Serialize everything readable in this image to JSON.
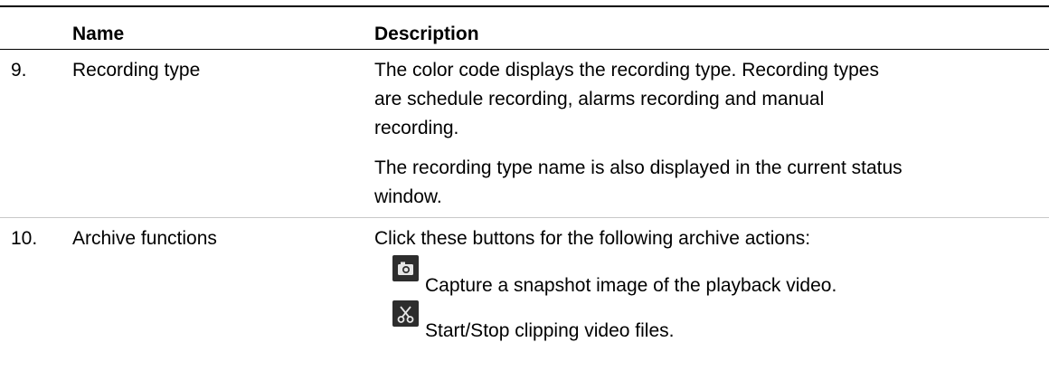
{
  "table": {
    "headers": {
      "name": "Name",
      "description": "Description"
    },
    "rows": [
      {
        "number": "9.",
        "name": "Recording type",
        "description_lines": [
          "The color code displays the recording type. Recording types",
          "are schedule recording, alarms recording and manual",
          "recording."
        ],
        "note_lines": [
          "The recording type name is also displayed in the current status",
          "window."
        ]
      },
      {
        "number": "10.",
        "name": "Archive functions",
        "intro": "Click these buttons for the following archive actions:",
        "actions": [
          {
            "icon": "camera-icon",
            "label": "Capture a snapshot image of the playback video."
          },
          {
            "icon": "scissors-icon",
            "label": "Start/Stop clipping video files."
          }
        ]
      }
    ]
  }
}
